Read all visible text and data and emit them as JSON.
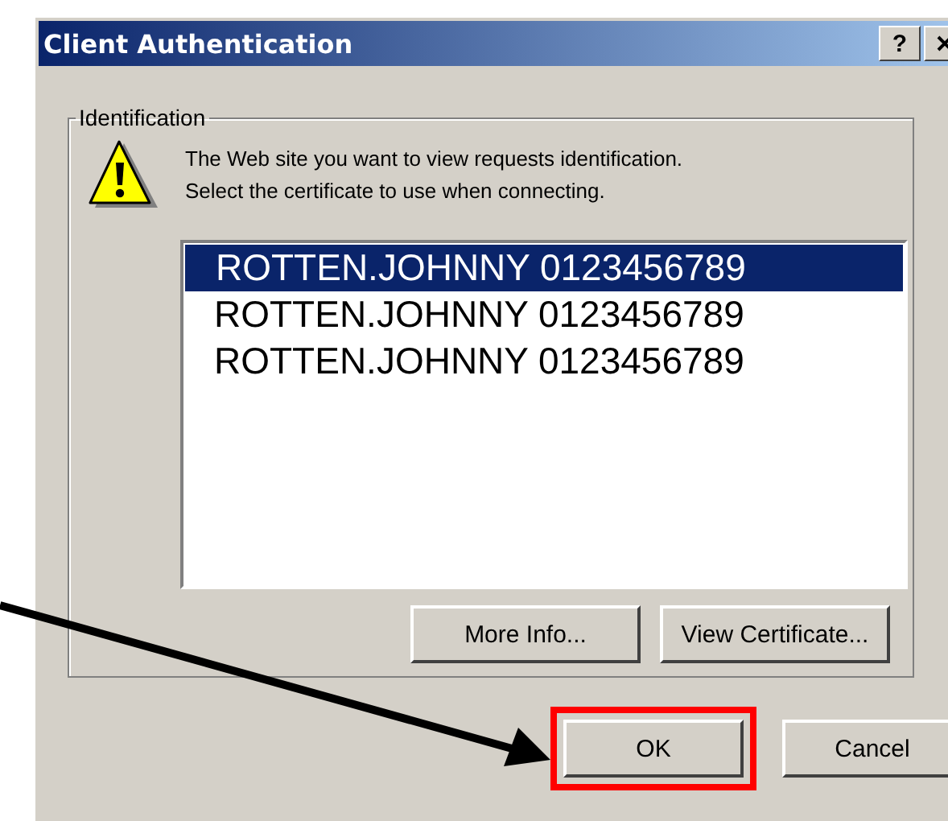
{
  "window": {
    "title": "Client Authentication",
    "help_button": "?"
  },
  "group": {
    "label": "Identification",
    "message_lines": [
      "The Web site you want to view requests identification.",
      "Select the certificate to use when connecting."
    ]
  },
  "certificates": [
    {
      "name": "ROTTEN.JOHNNY 0123456789",
      "selected": true
    },
    {
      "name": "ROTTEN.JOHNNY 0123456789",
      "selected": false
    },
    {
      "name": "ROTTEN.JOHNNY 0123456789",
      "selected": false
    }
  ],
  "list_buttons": [
    "More Info...",
    "View Certificate..."
  ],
  "buttons": [
    {
      "label": "OK",
      "highlighted": true
    },
    {
      "label": "Cancel",
      "highlighted": false
    }
  ]
}
